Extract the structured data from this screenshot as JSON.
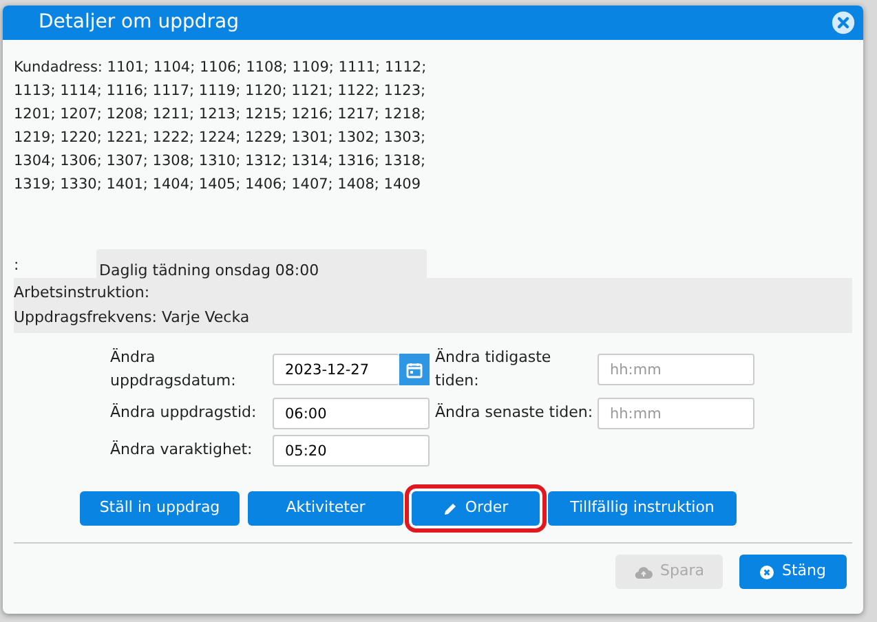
{
  "dialog": {
    "title": "Detaljer om uppdrag"
  },
  "customer_address": "Kundadress: 1101; 1104; 1106; 1108; 1109; 1111; 1112; 1113; 1114; 1116; 1117; 1119; 1120; 1121; 1122; 1123; 1201; 1207; 1208; 1211; 1213; 1215; 1216; 1217; 1218; 1219; 1220; 1221; 1222; 1224; 1229; 1301; 1302; 1303; 1304; 1306; 1307; 1308; 1310; 1312; 1314; 1316; 1318; 1319; 1330; 1401; 1404; 1405; 1406; 1407; 1408; 1409",
  "description": {
    "label": ":",
    "value": "Daglig tädning onsdag 08:00"
  },
  "info_lines": [
    "Arbetsinstruktion:",
    "Uppdragsfrekvens: Varje Vecka"
  ],
  "fields": [
    {
      "label": "Ändra uppdragsdatum:",
      "value": "2023-12-27",
      "kind": "date"
    },
    {
      "label": "Ändra tidigaste tiden:",
      "placeholder": "hh:mm",
      "kind": "text"
    },
    {
      "label": "Ändra uppdragstid:",
      "value": "06:00",
      "kind": "text"
    },
    {
      "label": "Ändra senaste tiden:",
      "placeholder": "hh:mm",
      "kind": "text"
    },
    {
      "label": "Ändra varaktighet:",
      "value": "05:20",
      "kind": "text"
    }
  ],
  "actions": [
    {
      "label": "Ställ in uppdrag",
      "kind": "plain",
      "highlighted": false
    },
    {
      "label": "Aktiviteter",
      "kind": "plain",
      "highlighted": false
    },
    {
      "label": "Order",
      "kind": "edit",
      "highlighted": true
    },
    {
      "label": "Tillfällig instruktion",
      "kind": "plain",
      "highlighted": false
    }
  ],
  "footer_buttons": [
    {
      "label": "Spara",
      "kind": "save",
      "disabled": true
    },
    {
      "label": "Stäng",
      "kind": "close",
      "disabled": false
    }
  ]
}
